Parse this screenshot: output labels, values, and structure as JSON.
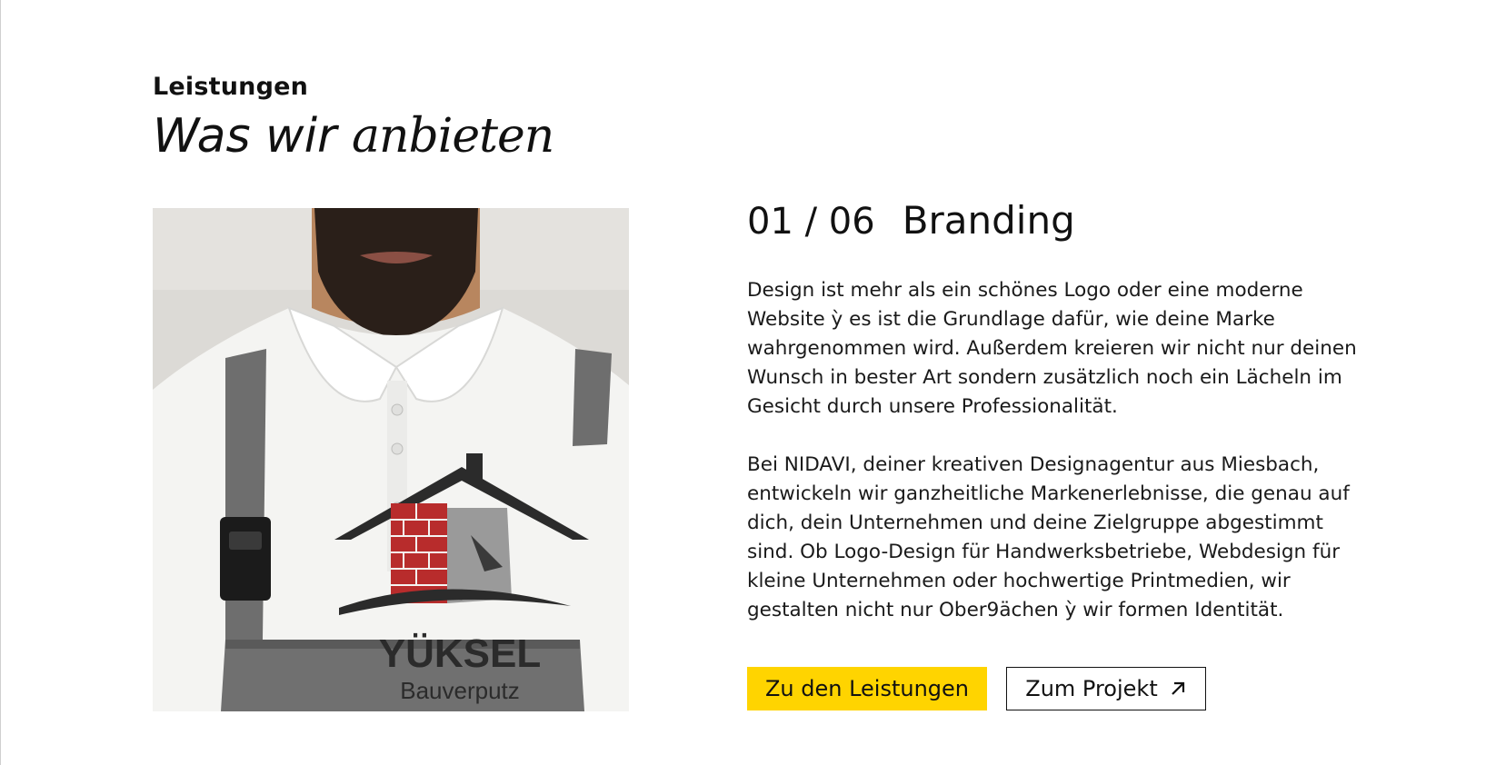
{
  "section": {
    "eyebrow": "Leistungen",
    "headline_part1": "Was wir ",
    "headline_part2": "anbieten"
  },
  "service": {
    "counter": "01 / 06",
    "title": "Branding",
    "paragraphs": [
      "Design ist mehr als ein schönes Logo oder eine moderne Website ỳ es ist die Grundlage dafür, wie deine Marke wahrgenommen wird. Außerdem kreieren wir nicht nur deinen Wunsch in bester Art sondern zusätzlich noch ein Lächeln im Gesicht durch unsere Professionalität.",
      "Bei NIDAVI, deiner kreativen Designagentur aus Miesbach, entwickeln wir ganzheitliche Markenerlebnisse, die genau auf dich, dein Unternehmen und deine Zielgruppe abgestimmt sind. Ob Logo-Design für Handwerksbetriebe, Webdesign für kleine Unternehmen oder hochwertige Printmedien, wir gestalten nicht nur Ober9ächen ỳ wir formen Identität."
    ]
  },
  "image": {
    "logo_name": "YÜKSEL",
    "logo_sub": "Bauverputz"
  },
  "buttons": {
    "primary_label": "Zu den Leistungen",
    "secondary_label": "Zum Projekt",
    "secondary_icon": "arrow-up-right-icon"
  },
  "colors": {
    "accent": "#ffd400",
    "text": "#111111",
    "background": "#ffffff"
  }
}
